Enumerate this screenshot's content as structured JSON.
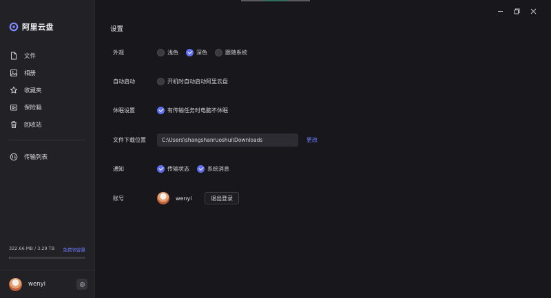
{
  "app": {
    "name": "阿里云盘"
  },
  "sidebar": {
    "items": [
      {
        "label": "文件",
        "icon": "file-icon"
      },
      {
        "label": "相册",
        "icon": "photo-icon"
      },
      {
        "label": "收藏夹",
        "icon": "star-icon"
      },
      {
        "label": "保险箱",
        "icon": "safe-icon"
      },
      {
        "label": "回收站",
        "icon": "trash-icon"
      }
    ],
    "transfer": {
      "label": "传输列表",
      "icon": "transfer-icon"
    },
    "storage": {
      "used_text": "322.66 MB / 3.29 TB",
      "link": "免费领容量",
      "used_fraction": 0.0001
    },
    "user": {
      "name": "wenyi"
    }
  },
  "settings": {
    "title": "设置",
    "appearance": {
      "label": "外观",
      "options": [
        "浅色",
        "深色",
        "跟随系统"
      ],
      "selected": "深色"
    },
    "autostart": {
      "label": "自动启动",
      "option": "开机时自动启动阿里云盘",
      "checked": false
    },
    "sleep": {
      "label": "休眠设置",
      "option": "有传输任务时电脑不休眠",
      "checked": true
    },
    "download": {
      "label": "文件下载位置",
      "path": "C:\\Users\\shangshanruoshui\\Downloads",
      "change": "更改"
    },
    "notify": {
      "label": "通知",
      "options": [
        "传输状态",
        "系统消息"
      ],
      "checked": [
        true,
        true
      ]
    },
    "account": {
      "label": "账号",
      "name": "wenyi",
      "logout": "退出登录"
    }
  },
  "colors": {
    "accent": "#6170f0",
    "link": "#6c7bff",
    "bg": "#18181c",
    "sidebar": "#212126"
  }
}
